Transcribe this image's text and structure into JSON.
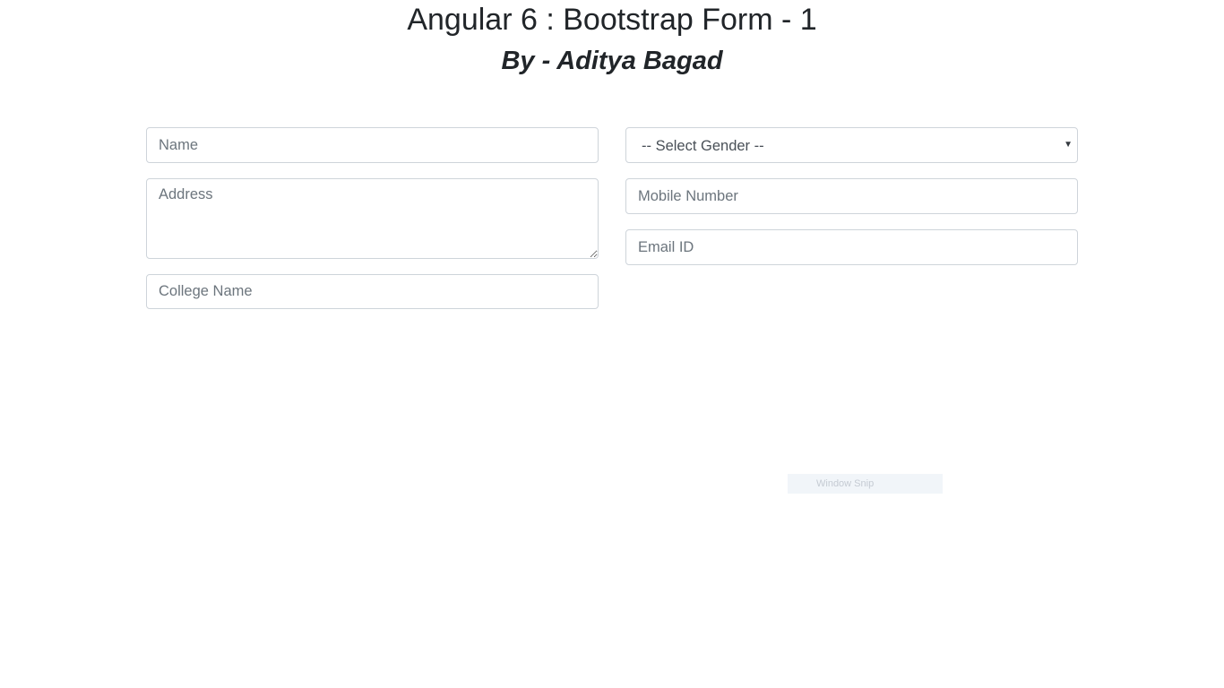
{
  "header": {
    "title": "Angular 6 : Bootstrap Form - 1",
    "subtitle": "By - Aditya Bagad"
  },
  "form": {
    "name": {
      "placeholder": "Name",
      "value": ""
    },
    "address": {
      "placeholder": "Address",
      "value": ""
    },
    "college": {
      "placeholder": "College Name",
      "value": ""
    },
    "gender": {
      "selected": "-- Select Gender --"
    },
    "mobile": {
      "placeholder": "Mobile Number",
      "value": ""
    },
    "email": {
      "placeholder": "Email ID",
      "value": ""
    }
  },
  "overlay": {
    "snip_label": "Window Snip"
  },
  "icons": {
    "select_arrow": "chevron-down-icon",
    "select_arrow_glyph": "▼"
  },
  "colors": {
    "text": "#212529",
    "border": "#ced4da",
    "placeholder": "#6c757d"
  }
}
